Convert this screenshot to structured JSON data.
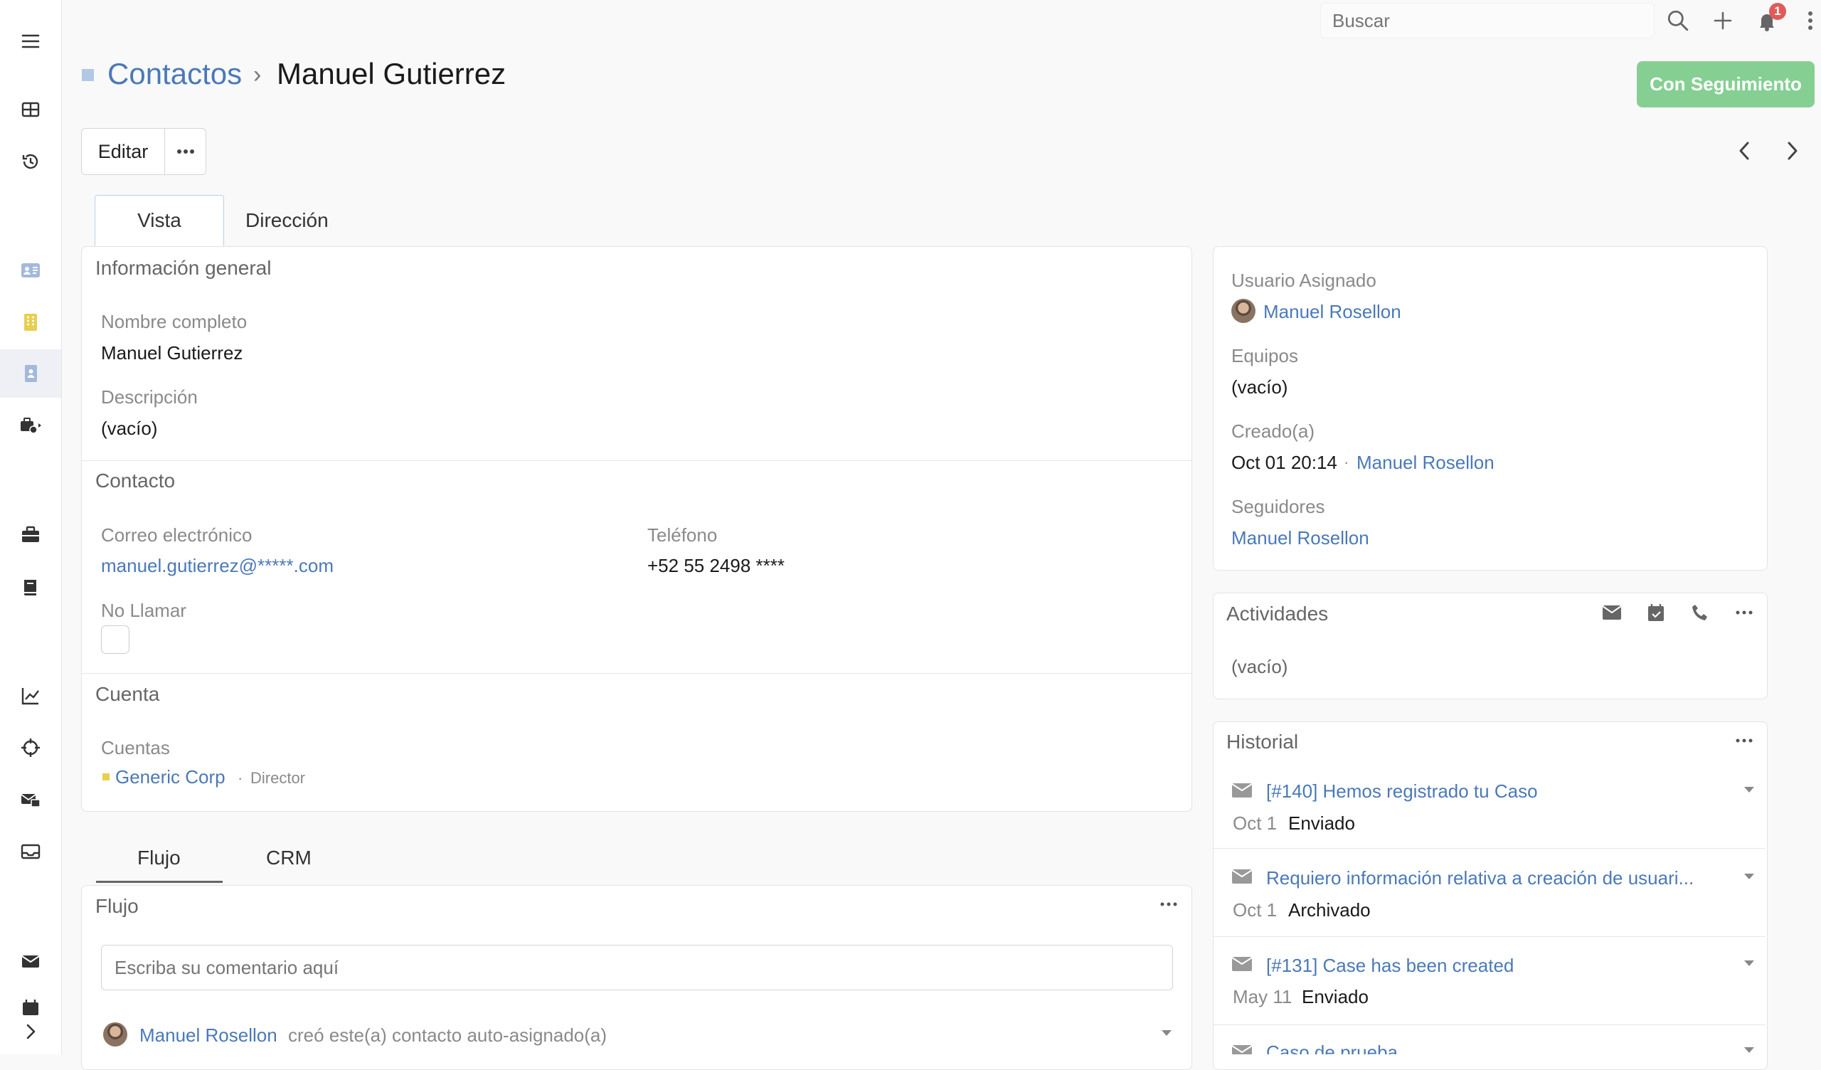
{
  "topbar": {
    "search_placeholder": "Buscar",
    "notification_count": "1"
  },
  "header": {
    "breadcrumb_parent": "Contactos",
    "breadcrumb_sep": "›",
    "record_title": "Manuel Gutierrez",
    "follow_button": "Con Seguimiento",
    "edit_button": "Editar"
  },
  "tabs": {
    "vista": "Vista",
    "direccion": "Dirección"
  },
  "general": {
    "title": "Información general",
    "fullname_label": "Nombre completo",
    "fullname_value": "Manuel Gutierrez",
    "description_label": "Descripción",
    "description_value": "(vacío)"
  },
  "contact": {
    "title": "Contacto",
    "email_label": "Correo electrónico",
    "email_value": "manuel.gutierrez@*****.com",
    "phone_label": "Teléfono",
    "phone_value": "+52 55 2498 ****",
    "donotcall_label": "No Llamar"
  },
  "account": {
    "title": "Cuenta",
    "accounts_label": "Cuentas",
    "account_name": "Generic Corp",
    "account_sep": "·",
    "account_role": "Director"
  },
  "lower_tabs": {
    "flujo": "Flujo",
    "crm": "CRM"
  },
  "stream": {
    "title": "Flujo",
    "comment_placeholder": "Escriba su comentario aquí",
    "entry_user": "Manuel Rosellon",
    "entry_text": "creó este(a) contacto auto-asignado(a)"
  },
  "side": {
    "assigned_label": "Usuario Asignado",
    "assigned_user": "Manuel Rosellon",
    "teams_label": "Equipos",
    "teams_value": "(vacío)",
    "created_label": "Creado(a)",
    "created_value": "Oct 01 20:14",
    "created_sep": "·",
    "created_by": "Manuel Rosellon",
    "followers_label": "Seguidores",
    "followers_value": "Manuel Rosellon"
  },
  "activities": {
    "title": "Actividades",
    "empty": "(vacío)"
  },
  "history": {
    "title": "Historial",
    "items": [
      {
        "subject": "[#140] Hemos registrado tu Caso",
        "date": "Oct 1",
        "status": "Enviado"
      },
      {
        "subject": "Requiero información relativa a creación de usuari...",
        "date": "Oct 1",
        "status": "Archivado"
      },
      {
        "subject": "[#131] Case has been created",
        "date": "May 11",
        "status": "Enviado"
      },
      {
        "subject": "Caso de prueba",
        "date": "",
        "status": ""
      }
    ]
  },
  "colors": {
    "link": "#4a79b8",
    "follow_button": "#86cf93",
    "badge": "#e05b5b"
  }
}
